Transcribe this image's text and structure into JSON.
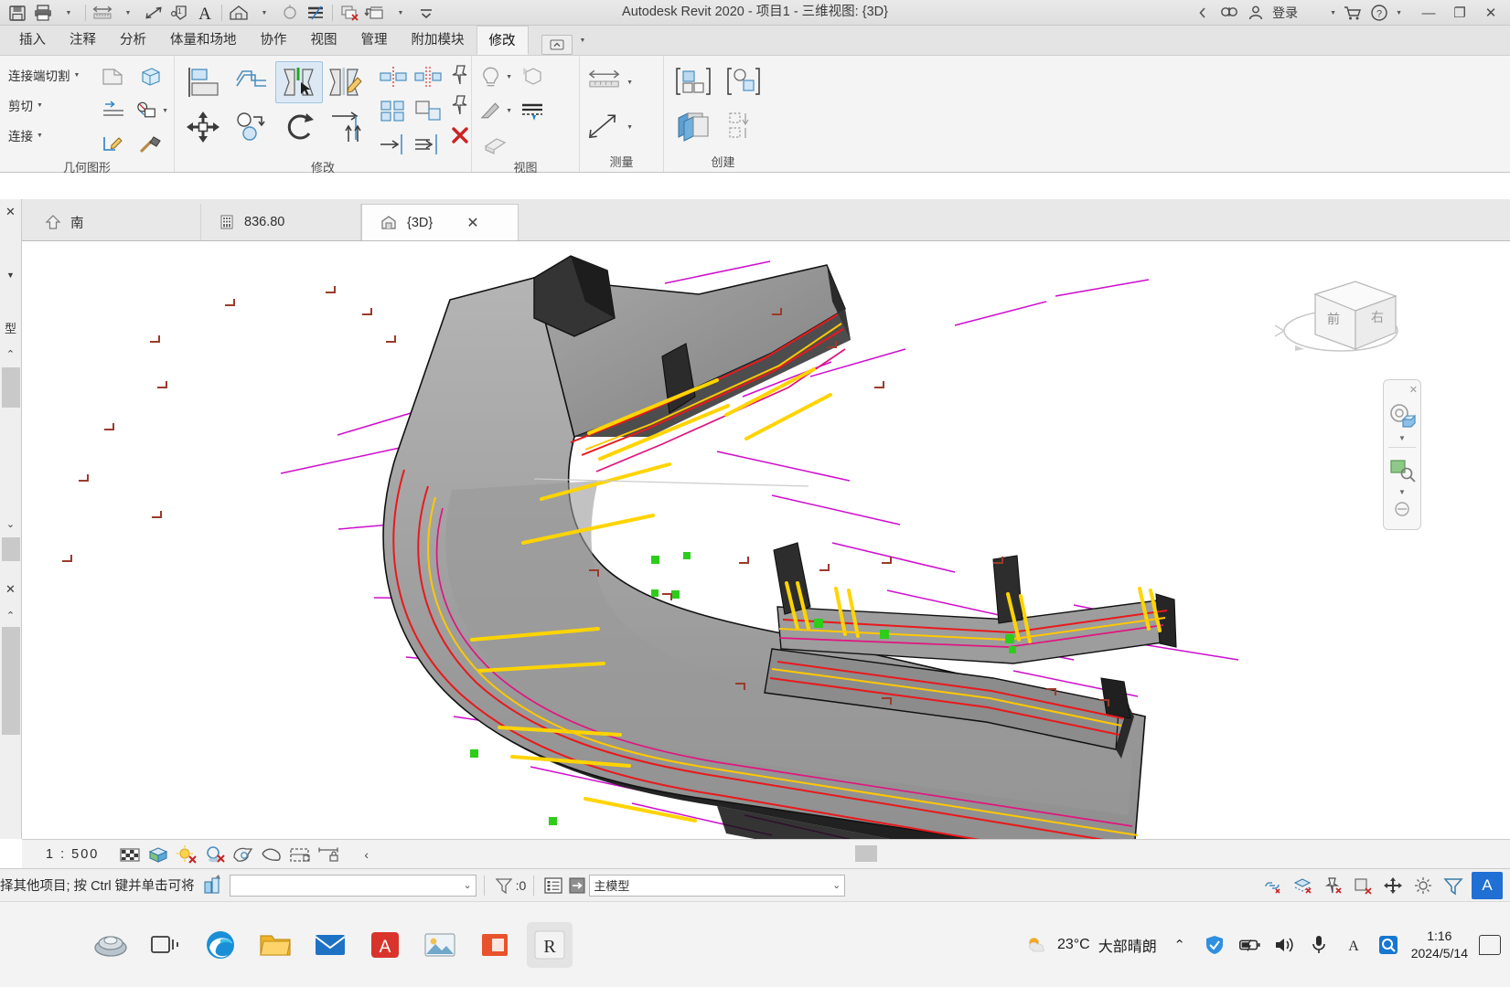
{
  "window": {
    "title": "Autodesk Revit 2020 - 项目1 - 三维视图: {3D}",
    "account_label": "登录",
    "minimize_glyph": "—",
    "restore_glyph": "❐",
    "close_glyph": "✕",
    "help_glyph": "?"
  },
  "quick_access": {
    "items": [
      {
        "name": "save-icon",
        "label": "保存"
      },
      {
        "name": "print-icon",
        "label": "打印"
      },
      {
        "name": "measure-icon",
        "label": "测量"
      },
      {
        "name": "aligned-dimension-icon",
        "label": "对齐尺寸标注"
      },
      {
        "name": "tag-icon",
        "label": "按类别标记"
      },
      {
        "name": "text-icon",
        "label": "文字"
      },
      {
        "name": "default-3d-view-icon",
        "label": "默认三维视图"
      },
      {
        "name": "section-icon",
        "label": "剖面"
      },
      {
        "name": "thin-lines-icon",
        "label": "细线"
      },
      {
        "name": "close-hidden-windows-icon",
        "label": "关闭隐藏窗口"
      },
      {
        "name": "switch-windows-icon",
        "label": "切换窗口"
      },
      {
        "name": "customize-qat-icon",
        "label": "自定义快速访问工具栏"
      }
    ]
  },
  "ribbon": {
    "tabs": [
      {
        "label": "插入",
        "active": false
      },
      {
        "label": "注释",
        "active": false
      },
      {
        "label": "分析",
        "active": false
      },
      {
        "label": "体量和场地",
        "active": false
      },
      {
        "label": "协作",
        "active": false
      },
      {
        "label": "视图",
        "active": false
      },
      {
        "label": "管理",
        "active": false
      },
      {
        "label": "附加模块",
        "active": false
      },
      {
        "label": "修改",
        "active": true
      }
    ],
    "panels": [
      {
        "label": "几何图形",
        "rows": [
          {
            "label": "连接端切割",
            "dropdown": true
          },
          {
            "label": "剪切",
            "dropdown": true
          },
          {
            "label": "连接",
            "dropdown": true
          }
        ],
        "tools": [
          {
            "name": "cut-geometry-icon",
            "label": "剪切几何图形"
          },
          {
            "name": "demolish-icon",
            "label": "拆除"
          },
          {
            "name": "split-face-icon",
            "label": "拆分面"
          },
          {
            "name": "paint-geometry-icon",
            "label": "填色"
          },
          {
            "name": "beam-join-icon",
            "label": "梁/柱连接"
          },
          {
            "name": "hammer-icon",
            "label": "拆除"
          }
        ]
      },
      {
        "label": "修改",
        "tools": [
          {
            "name": "align-icon",
            "label": "对齐"
          },
          {
            "name": "offset-icon",
            "label": "偏移"
          },
          {
            "name": "mirror-pick-axis-icon",
            "label": "镜像-拾取轴",
            "selected": true
          },
          {
            "name": "mirror-draw-axis-icon",
            "label": "镜像-绘制轴"
          },
          {
            "name": "split-element-icon",
            "label": "拆分图元"
          },
          {
            "name": "split-with-gap-icon",
            "label": "用间隙拆分"
          },
          {
            "name": "trim-extend-corner-icon",
            "label": "修剪/延伸为角"
          },
          {
            "name": "move-icon",
            "label": "移动"
          },
          {
            "name": "copy-icon",
            "label": "复制"
          },
          {
            "name": "rotate-icon",
            "label": "旋转"
          },
          {
            "name": "array-icon",
            "label": "阵列"
          },
          {
            "name": "scale-icon",
            "label": "缩放"
          },
          {
            "name": "pin-icon",
            "label": "锁定"
          },
          {
            "name": "trim-single-icon",
            "label": "修剪单个图元"
          },
          {
            "name": "trim-multiple-icon",
            "label": "修剪多个图元"
          },
          {
            "name": "delete-icon",
            "label": "删除"
          }
        ]
      },
      {
        "label": "视图",
        "tools": [
          {
            "name": "reveal-hidden-elements-icon",
            "label": "显示隐藏的图元"
          },
          {
            "name": "hide-element-icon",
            "label": "在视图中隐藏"
          },
          {
            "name": "override-graphics-icon",
            "label": "替换视图中的图形"
          },
          {
            "name": "linework-icon",
            "label": "线处理"
          },
          {
            "name": "cutback-icon",
            "label": "剖面框"
          }
        ]
      },
      {
        "label": "测量",
        "tools": [
          {
            "name": "measure-between-references-icon",
            "label": "测量两个参照之间的距离"
          },
          {
            "name": "measure-along-element-icon",
            "label": "沿图元测量"
          }
        ]
      },
      {
        "label": "创建",
        "tools": [
          {
            "name": "create-similar-icon",
            "label": "创建类似实例"
          },
          {
            "name": "edit-family-icon",
            "label": "编辑族"
          },
          {
            "name": "create-group-icon",
            "label": "创建组"
          },
          {
            "name": "create-parts-icon",
            "label": "创建零件"
          }
        ]
      }
    ]
  },
  "view_tabs": {
    "close_all_glyph": "✕",
    "items": [
      {
        "label": "南",
        "icon": "elevation-icon",
        "active": false
      },
      {
        "label": "836.80",
        "icon": "section-view-icon",
        "active": false
      },
      {
        "label": "{3D}",
        "icon": "3d-view-icon",
        "active": true,
        "close_glyph": "✕"
      }
    ]
  },
  "left_dock": {
    "properties_close_glyph": "✕",
    "properties_collapse_glyph": "⌃",
    "type_selector_label": "型",
    "browser_close_glyph": "✕",
    "browser_collapse_glyph": "⌃",
    "dropdown_glyph": "▼",
    "down_glyph": "⌄"
  },
  "canvas": {
    "viewcube": {
      "face_front": "前",
      "face_right": "右"
    },
    "navbar": {
      "close_glyph": "✕",
      "items": [
        {
          "name": "steering-wheel-icon",
          "label": "全导航控制盘"
        },
        {
          "name": "zoom-region-icon",
          "label": "缩放区域"
        },
        {
          "name": "pan-icon",
          "label": "平移"
        }
      ]
    },
    "model": {
      "description": "三维道路/桥梁模型",
      "colors": {
        "deck_top": "#9d9d9d",
        "deck_side": "#2e2e2e",
        "lane_marking": "#ffd400",
        "edge_line": "#e8191c",
        "alignment_line": "#cc00cc",
        "node_marker": "#2ecc1b"
      }
    }
  },
  "view_control_bar": {
    "scale": "1 : 500",
    "icons": [
      {
        "name": "detail-level-icon",
        "label": "详细程度"
      },
      {
        "name": "visual-style-icon",
        "label": "视觉样式"
      },
      {
        "name": "sun-path-off-icon",
        "label": "日光路径关闭"
      },
      {
        "name": "shadows-off-icon",
        "label": "阴影关闭"
      },
      {
        "name": "rendering-dialog-icon",
        "label": "显示渲染对话框"
      },
      {
        "name": "crop-view-icon",
        "label": "裁剪视图"
      },
      {
        "name": "crop-region-visible-icon",
        "label": "显示裁剪区域"
      },
      {
        "name": "lock-3d-view-icon",
        "label": "锁定三维视图"
      }
    ],
    "expand_glyph": "‹"
  },
  "status_bar": {
    "message": "择其他项目; 按 Ctrl 键并单击可将",
    "select-tools-icon": "select-tools-icon",
    "combo_value": "",
    "combo_dropdown_glyph": "⌄",
    "filter_count": ":0",
    "worksets_label": "主模型",
    "worksets_dropdown_glyph": "⌄",
    "right_icons": [
      {
        "name": "select-links-icon",
        "label": "选择链接"
      },
      {
        "name": "select-underlay-icon",
        "label": "选择底图图元"
      },
      {
        "name": "select-pinned-icon",
        "label": "选择锁定图元"
      },
      {
        "name": "select-by-face-icon",
        "label": "按面选择图元"
      },
      {
        "name": "drag-elements-icon",
        "label": "拖曳图元"
      },
      {
        "name": "settings-gear-icon",
        "label": "设置"
      },
      {
        "name": "filter-icon",
        "label": "过滤器"
      }
    ],
    "avatar_letter": "A"
  },
  "taskbar": {
    "apps": [
      {
        "name": "start-icon",
        "label": "开始"
      },
      {
        "name": "task-view-icon",
        "label": "任务视图"
      },
      {
        "name": "edge-icon",
        "label": "Microsoft Edge"
      },
      {
        "name": "file-explorer-icon",
        "label": "文件资源管理器"
      },
      {
        "name": "mail-icon",
        "label": "邮件"
      },
      {
        "name": "autodesk-icon",
        "label": "Autodesk"
      },
      {
        "name": "photos-icon",
        "label": "照片"
      },
      {
        "name": "office-icon",
        "label": "Office"
      },
      {
        "name": "revit-icon",
        "label": "Revit",
        "active": true
      }
    ],
    "tray": {
      "weather_temp": "23°C",
      "weather_desc": "大部晴朗",
      "chevron_glyph": "⌃",
      "icons": [
        {
          "name": "security-shield-icon",
          "label": "安全防护"
        },
        {
          "name": "battery-icon",
          "label": "电池"
        },
        {
          "name": "volume-icon",
          "label": "音量"
        },
        {
          "name": "microphone-icon",
          "label": "麦克风"
        },
        {
          "name": "ime-icon",
          "label": "输入法"
        },
        {
          "name": "search-app-icon",
          "label": "搜索"
        }
      ],
      "time": "1:16",
      "date": "2024/5/14",
      "notification_label": "通知"
    }
  }
}
